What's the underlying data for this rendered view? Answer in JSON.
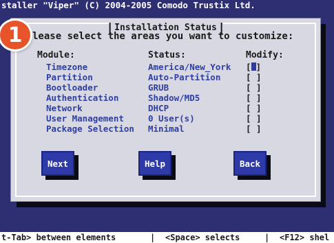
{
  "top_title": "staller \"Viper\" (C) 2004-2005 Comodo Trustix Ltd.",
  "dialog": {
    "title": "Installation Status",
    "prompt": "lease select the areas you want to customize:"
  },
  "table": {
    "headers": {
      "module": "Module:",
      "status": "Status:",
      "modify": "Modify:"
    },
    "rows": [
      {
        "module": "Timezone",
        "status": "America/New_York",
        "modify": "[ ]",
        "focused": true
      },
      {
        "module": "Partition",
        "status": "Auto-Partition",
        "modify": "[ ]",
        "focused": false
      },
      {
        "module": "Bootloader",
        "status": "GRUB",
        "modify": "[ ]",
        "focused": false
      },
      {
        "module": "Authentication",
        "status": "Shadow/MD5",
        "modify": "[ ]",
        "focused": false
      },
      {
        "module": "Network",
        "status": "DHCP",
        "modify": "[ ]",
        "focused": false
      },
      {
        "module": "User Management",
        "status": "0 User(s)",
        "modify": "[ ]",
        "focused": false
      },
      {
        "module": "Package Selection",
        "status": "Minimal",
        "modify": "[ ]",
        "focused": false
      }
    ]
  },
  "buttons": {
    "next": "Next",
    "help": "Help",
    "back": "Back"
  },
  "help_line": {
    "tab": "t-Tab> between elements",
    "sep1": "|",
    "space": "<Space> selects",
    "sep2": "|",
    "f12": "<F12> shel"
  },
  "badge": {
    "number": "1"
  },
  "colors": {
    "screen_bg": "#2e2f73",
    "dialog_bg": "#d8d8e2",
    "button_bg": "#2e3aa8",
    "value_text": "#2f3fa0",
    "badge": "#e8542a"
  }
}
